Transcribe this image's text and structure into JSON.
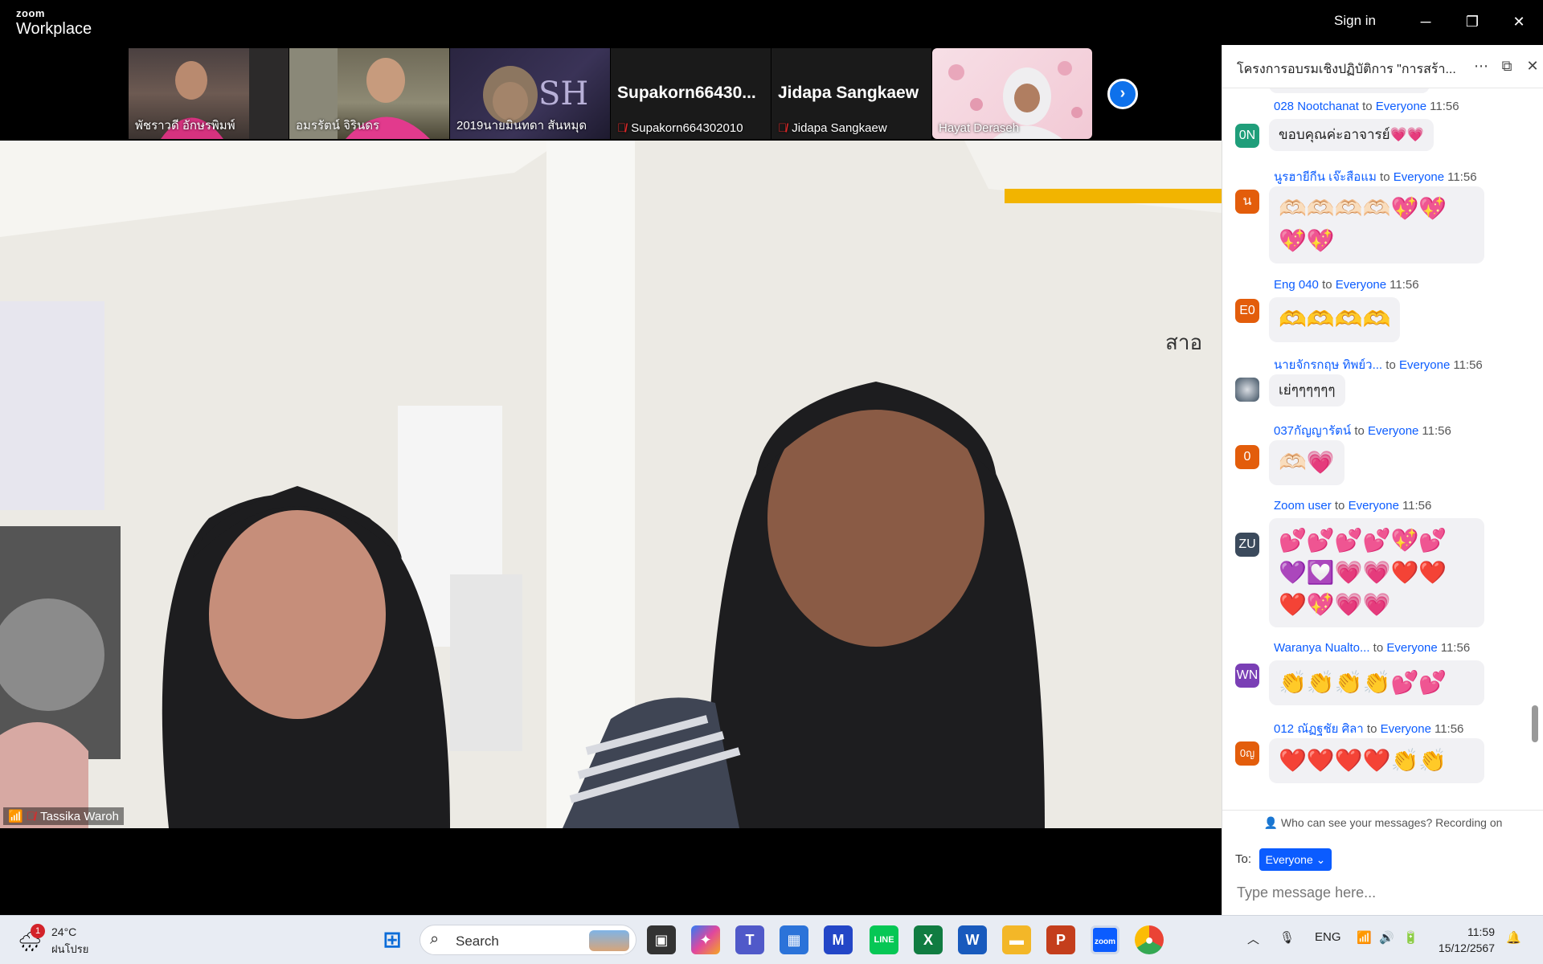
{
  "titlebar": {
    "brand_small": "zoom",
    "brand_big": "Workplace",
    "signin": "Sign in",
    "minimize": "─",
    "restore": "❐",
    "close": "✕"
  },
  "participants": [
    {
      "name": "พัชราวดี อักษรพิมพ์",
      "muted": false
    },
    {
      "name": "อมรรัตน์ จิรินดร",
      "muted": false
    },
    {
      "name": "2019นายมินทดา สันหมุด",
      "muted": false
    },
    {
      "name": "Supakorn664302010",
      "display": "Supakorn66430...",
      "muted": true
    },
    {
      "name": "Jidapa Sangkaew",
      "display": "Jidapa Sangkaew",
      "muted": true
    },
    {
      "name": "Hayat Deraseh",
      "muted": false
    }
  ],
  "main_video": {
    "name": "Tassika Waroh"
  },
  "chat": {
    "title": "โครงการอบรมเชิงปฏิบัติการ \"การสร้า...",
    "messages": [
      {
        "avatar": "0N",
        "avatar_color": "#1f9e7a",
        "sender": "028 Nootchanat",
        "to": "to",
        "target": "Everyone",
        "time": "11:56",
        "text": "ขอบคุณค่ะอาจารย์💗💗"
      },
      {
        "avatar": "น",
        "avatar_color": "#e35d0b",
        "sender": "นูรฮายีกีน เจ๊ะสือแม",
        "to": "to",
        "target": "Everyone",
        "time": "11:56",
        "line1": "🫶🏻🫶🏻🫶🏻🫶🏻💖💖",
        "line2": "💖💖"
      },
      {
        "avatar": "E0",
        "avatar_color": "#e35d0b",
        "sender": "Eng 040",
        "to": "to",
        "target": "Everyone",
        "time": "11:56",
        "text": "🫶🫶🫶🫶"
      },
      {
        "avatar": "",
        "avatar_color": "#5b6b7a",
        "sender": "นายจักรกฤษ ทิพย์ว...",
        "to": "to",
        "target": "Everyone",
        "time": "11:56",
        "text": "เย่ๆๆๆๆๆๆ"
      },
      {
        "avatar": "0",
        "avatar_color": "#e35d0b",
        "sender": "037กัญญารัตน์",
        "to": "to",
        "target": "Everyone",
        "time": "11:56",
        "text": "🫶🏻💗"
      },
      {
        "avatar": "ZU",
        "avatar_color": "#3b4a5c",
        "sender": "Zoom user",
        "to": "to",
        "target": "Everyone",
        "time": "11:56",
        "line1": "💕💕💕💕💖💕",
        "line2": "💜💟💗💗❤️❤️",
        "line3": "❤️💖💗💗"
      },
      {
        "avatar": "WN",
        "avatar_color": "#7a3fb5",
        "sender": "Waranya Nualto...",
        "to": "to",
        "target": "Everyone",
        "time": "11:56",
        "text": "👏👏👏👏💕💕"
      },
      {
        "avatar": "0ญ",
        "avatar_color": "#e35d0b",
        "sender": "012 ณัฏฐชัย ศิลา",
        "to": "to",
        "target": "Everyone",
        "time": "11:56",
        "text": "❤️❤️❤️❤️👏👏"
      }
    ],
    "privacy_note": "Who can see your messages? Recording on",
    "to_label": "To:",
    "to_value": "Everyone",
    "input_placeholder": "Type message here..."
  },
  "taskbar": {
    "weather_temp": "24°C",
    "weather_cond": "ฝนโปรย",
    "weather_badge": "1",
    "search": "Search",
    "lang": "ENG",
    "time": "11:59",
    "date": "15/12/2567"
  },
  "colors": {
    "accent": "#0b5cff",
    "zoom_blue": "#0e71eb"
  }
}
